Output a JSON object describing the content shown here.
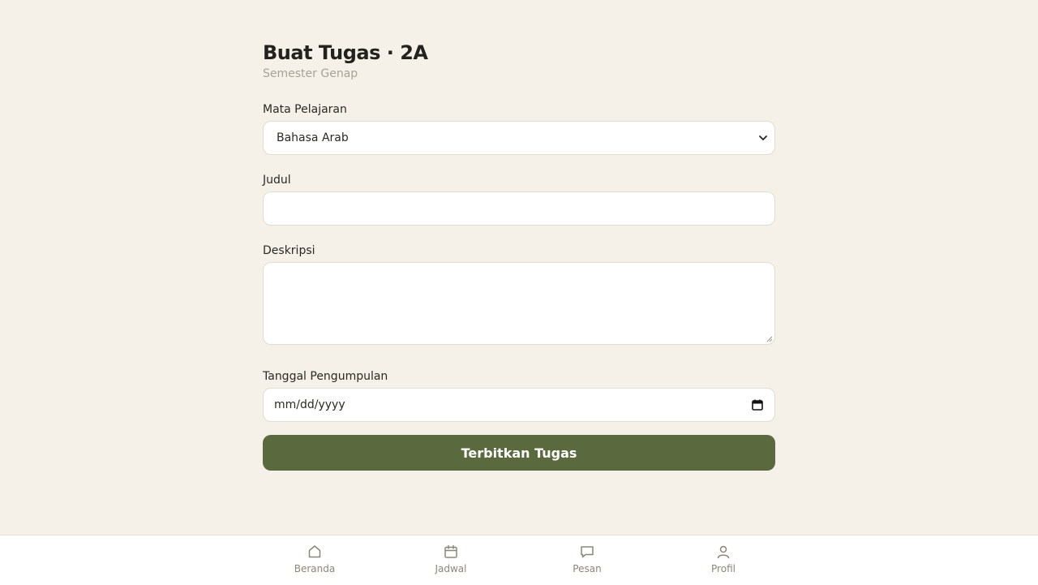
{
  "header": {
    "title": "Buat Tugas · 2A",
    "subtitle": "Semester Genap"
  },
  "form": {
    "subject": {
      "label": "Mata Pelajaran",
      "value": "Bahasa Arab"
    },
    "title_field": {
      "label": "Judul",
      "value": ""
    },
    "description": {
      "label": "Deskripsi",
      "value": ""
    },
    "due_date": {
      "label": "Tanggal Pengumpulan",
      "placeholder": "mm/dd/yyyy"
    },
    "submit_label": "Terbitkan Tugas"
  },
  "nav": {
    "items": [
      {
        "label": "Beranda",
        "icon": "home-icon"
      },
      {
        "label": "Jadwal",
        "icon": "calendar-icon"
      },
      {
        "label": "Pesan",
        "icon": "message-icon"
      },
      {
        "label": "Profil",
        "icon": "user-icon"
      }
    ]
  },
  "colors": {
    "background": "#f5f0e8",
    "accent": "#5b6a3e",
    "nav_text": "#8c8677"
  }
}
